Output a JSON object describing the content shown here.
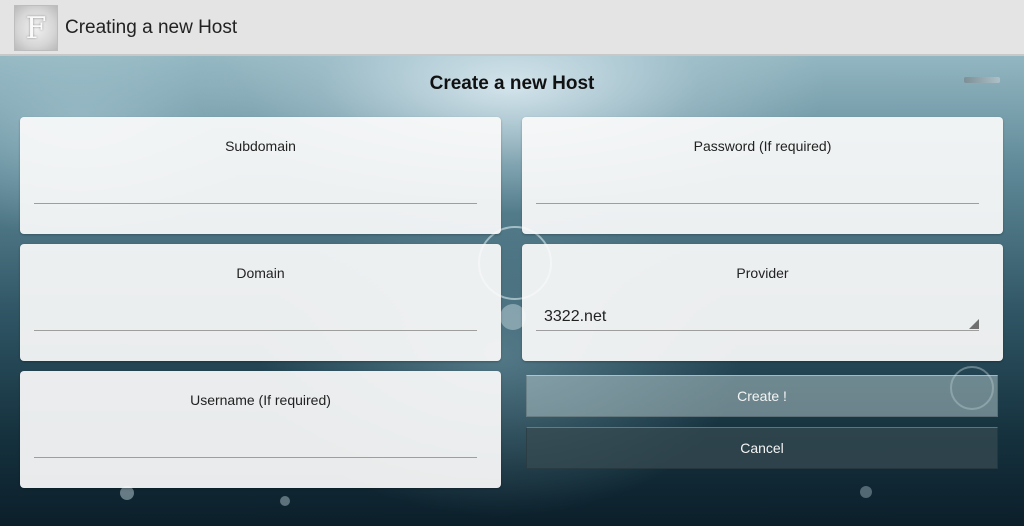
{
  "app_bar": {
    "logo_letter": "F",
    "title": "Creating a new Host"
  },
  "form": {
    "heading": "Create a new Host",
    "subdomain": {
      "label": "Subdomain",
      "value": ""
    },
    "password": {
      "label": "Password (If required)",
      "value": ""
    },
    "domain": {
      "label": "Domain",
      "value": ""
    },
    "provider": {
      "label": "Provider",
      "value": "3322.net"
    },
    "username": {
      "label": "Username (If required)",
      "value": ""
    }
  },
  "actions": {
    "create_label": "Create !",
    "cancel_label": "Cancel"
  },
  "icons": {
    "logo": "app-logo-icon",
    "dropdown": "dropdown-triangle-icon",
    "overflow": "overflow-menu-icon"
  },
  "colors": {
    "action_bar": "#e4e4e4",
    "card_background": "#fafafa",
    "create_button": "#afc3c6",
    "cancel_button": "#374b52"
  }
}
